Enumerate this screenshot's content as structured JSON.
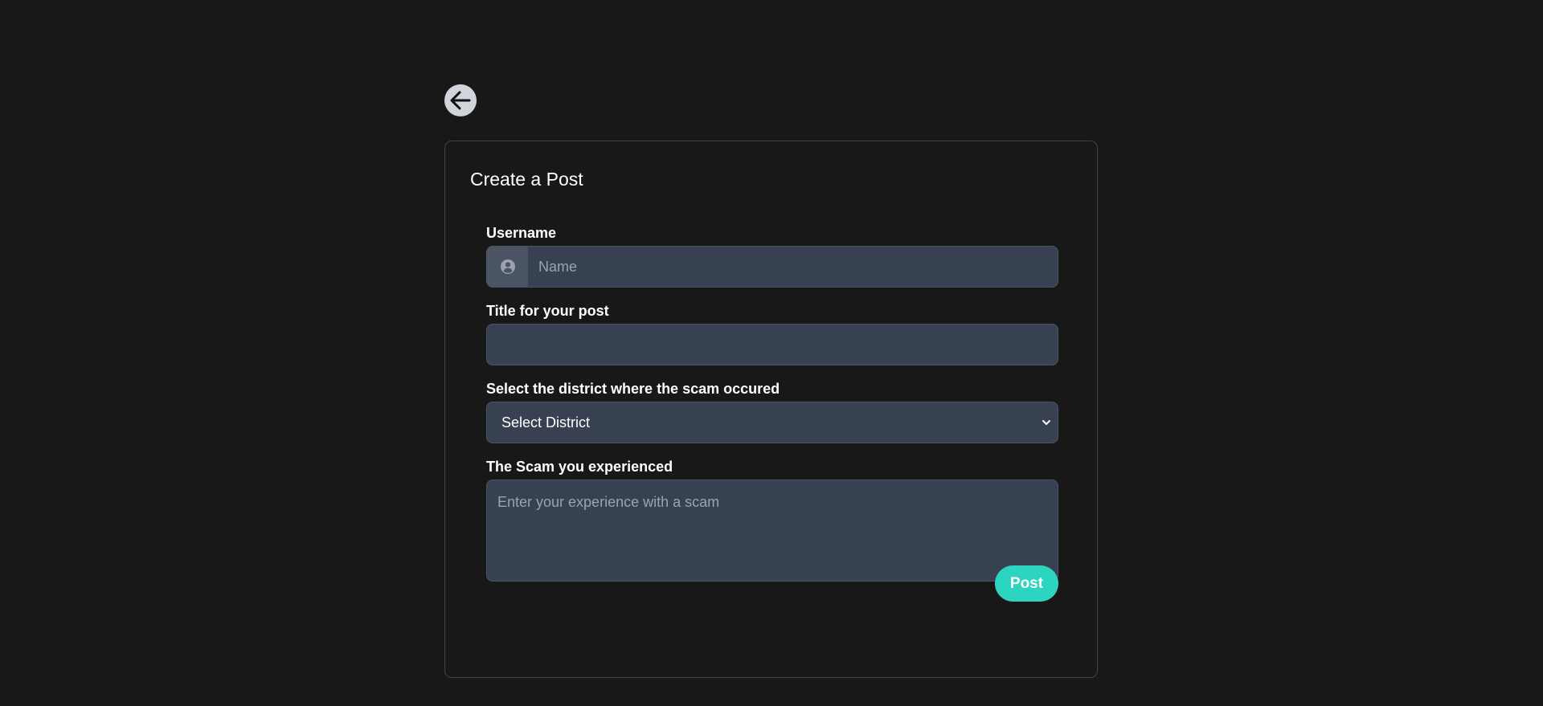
{
  "nav": {
    "back_icon": "arrow-left-icon"
  },
  "form": {
    "title": "Create a Post",
    "username": {
      "label": "Username",
      "placeholder": "Name",
      "value": "",
      "icon": "user-circle-icon"
    },
    "post_title": {
      "label": "Title for your post",
      "placeholder": "",
      "value": ""
    },
    "district": {
      "label": "Select the district where the scam occured",
      "selected": "Select District",
      "icon": "chevron-down-icon"
    },
    "experience": {
      "label": "The Scam you experienced",
      "placeholder": "Enter your experience with a scam",
      "value": ""
    },
    "submit_label": "Post"
  },
  "colors": {
    "background": "#181818",
    "input_bg": "#374151",
    "addon_bg": "#4b5563",
    "accent": "#2dd4bf"
  }
}
